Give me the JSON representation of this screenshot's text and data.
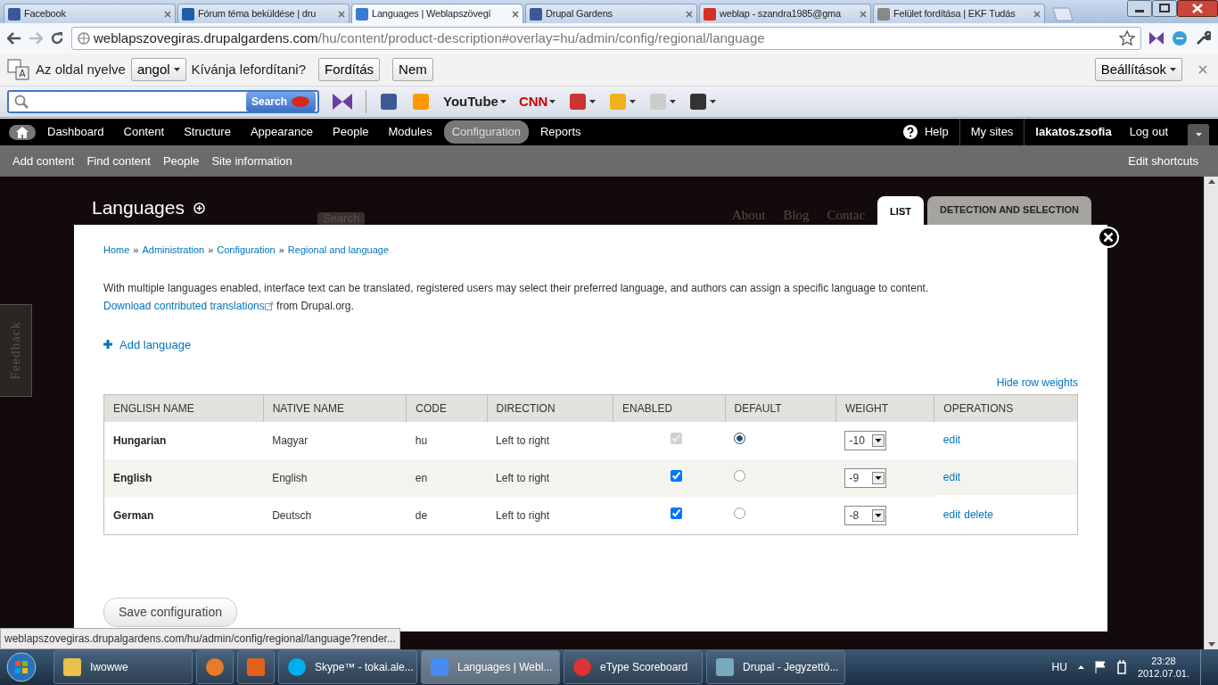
{
  "browser": {
    "tabs": [
      {
        "title": "Facebook",
        "selected": false
      },
      {
        "title": "Fórum téma beküldése | dru",
        "selected": false
      },
      {
        "title": "Languages | Weblapszövegí",
        "selected": true
      },
      {
        "title": "Drupal Gardens",
        "selected": false
      },
      {
        "title": "weblap - szandra1985@gma",
        "selected": false
      },
      {
        "title": "Felület fordítása | EKF Tudás",
        "selected": false
      }
    ],
    "address": {
      "domain": "weblapszovegiras.drupalgardens.com",
      "path": "/hu/content/product-description#overlay=hu/admin/config/regional/language"
    },
    "translate_bar": {
      "label": "Az oldal nyelve",
      "language": "angol",
      "question": "Kívánja lefordítani?",
      "buttons": [
        "Fordítás",
        "Nem"
      ],
      "settings": "Beállítások"
    },
    "ask_toolbar": {
      "search_button": "Search",
      "items": [
        {
          "kind": "icon",
          "dropdown": false
        },
        {
          "kind": "icon",
          "dropdown": false
        },
        {
          "kind": "logo",
          "text": "YouTube",
          "dropdown": true
        },
        {
          "kind": "logo",
          "text": "CNN",
          "dropdown": true
        },
        {
          "kind": "icon",
          "dropdown": true
        },
        {
          "kind": "icon",
          "dropdown": true
        },
        {
          "kind": "icon",
          "dropdown": true
        },
        {
          "kind": "icon",
          "dropdown": true
        }
      ]
    }
  },
  "admin_toolbar": {
    "menu": [
      {
        "label": "Dashboard",
        "selected": false
      },
      {
        "label": "Content",
        "selected": false
      },
      {
        "label": "Structure",
        "selected": false
      },
      {
        "label": "Appearance",
        "selected": false
      },
      {
        "label": "People",
        "selected": false
      },
      {
        "label": "Modules",
        "selected": false
      },
      {
        "label": "Configuration",
        "selected": true
      },
      {
        "label": "Reports",
        "selected": false
      }
    ],
    "help": "Help",
    "my_sites": "My sites",
    "user": "lakatos.zsofia",
    "logout": "Log out",
    "shortcuts": [
      "Add content",
      "Find content",
      "People",
      "Site information"
    ],
    "edit_shortcuts": "Edit shortcuts"
  },
  "page": {
    "title": "Languages",
    "search_button": "Search",
    "site_links": [
      "About",
      "Blog",
      "Contac"
    ],
    "feedback": "Feedback"
  },
  "overlay": {
    "tabs": [
      {
        "label": "LIST",
        "selected": true
      },
      {
        "label": "DETECTION AND SELECTION",
        "selected": false
      }
    ],
    "breadcrumb": [
      "Home",
      "Administration",
      "Configuration",
      "Regional and language"
    ],
    "breadcrumb_separator": "»",
    "description": {
      "text": "With multiple languages enabled, interface text can be translated, registered users may select their preferred language, and authors can assign a specific language to content.",
      "link": "Download contributed translations",
      "after": "from Drupal.org."
    },
    "add_language": "Add language",
    "hide_weights": "Hide row weights",
    "table": {
      "columns": [
        "ENGLISH NAME",
        "NATIVE NAME",
        "CODE",
        "DIRECTION",
        "ENABLED",
        "DEFAULT",
        "WEIGHT",
        "OPERATIONS"
      ],
      "rows": [
        {
          "english_name": "Hungarian",
          "native_name": "Magyar",
          "code": "hu",
          "direction": "Left to right",
          "enabled": true,
          "disabled": true,
          "selected": true,
          "weight": "-10",
          "operations": [
            "edit"
          ]
        },
        {
          "english_name": "English",
          "native_name": "English",
          "code": "en",
          "direction": "Left to right",
          "enabled": true,
          "disabled": false,
          "selected": false,
          "weight": "-9",
          "operations": [
            "edit"
          ]
        },
        {
          "english_name": "German",
          "native_name": "Deutsch",
          "code": "de",
          "direction": "Left to right",
          "enabled": true,
          "disabled": false,
          "selected": false,
          "weight": "-8",
          "operations": [
            "edit",
            "delete"
          ]
        }
      ]
    },
    "save_button": "Save configuration"
  },
  "status_url": "weblapszovegiras.drupalgardens.com/hu/admin/config/regional/language?render...",
  "taskbar": {
    "items": [
      {
        "label": "Iwowwe",
        "selected": false
      },
      {
        "selected": false
      },
      {
        "selected": false
      },
      {
        "label": "Skype™ - tokai.ale...",
        "selected": false
      },
      {
        "label": "Languages | Webl...",
        "selected": true
      },
      {
        "label": "eType Scoreboard",
        "selected": false
      },
      {
        "label": "Drupal - Jegyzettö...",
        "selected": false
      }
    ],
    "language": "HU",
    "time": "23:28",
    "date": "2012.07.01."
  }
}
